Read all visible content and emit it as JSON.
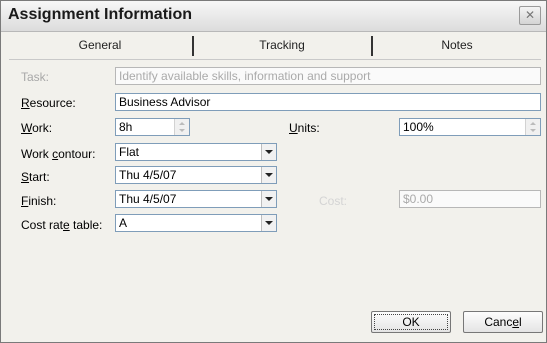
{
  "dialog": {
    "title": "Assignment Information",
    "close_glyph": "✕"
  },
  "tabs": [
    {
      "label": "General"
    },
    {
      "label": "Tracking"
    },
    {
      "label": "Notes"
    }
  ],
  "form": {
    "task": {
      "label": "Task:",
      "value": "Identify available skills, information and support"
    },
    "resource": {
      "pre": "",
      "accel": "R",
      "post": "esource:",
      "value": "Business Advisor"
    },
    "work": {
      "pre": "",
      "accel": "W",
      "post": "ork:",
      "value": "8h"
    },
    "units": {
      "pre": "",
      "accel": "U",
      "post": "nits:",
      "value": "100%"
    },
    "work_contour": {
      "pre": "Work ",
      "accel": "c",
      "post": "ontour:",
      "value": "Flat"
    },
    "start": {
      "pre": "",
      "accel": "S",
      "post": "tart:",
      "value": "Thu 4/5/07"
    },
    "finish": {
      "pre": "",
      "accel": "F",
      "post": "inish:",
      "value": "Thu 4/5/07"
    },
    "cost": {
      "label": "Cost:",
      "value": "$0.00"
    },
    "cost_rate_table": {
      "pre": "Cost rat",
      "accel": "e",
      "post": " table:",
      "value": "A"
    }
  },
  "buttons": {
    "ok": "OK",
    "cancel_pre": "Canc",
    "cancel_accel": "e",
    "cancel_post": "l"
  }
}
